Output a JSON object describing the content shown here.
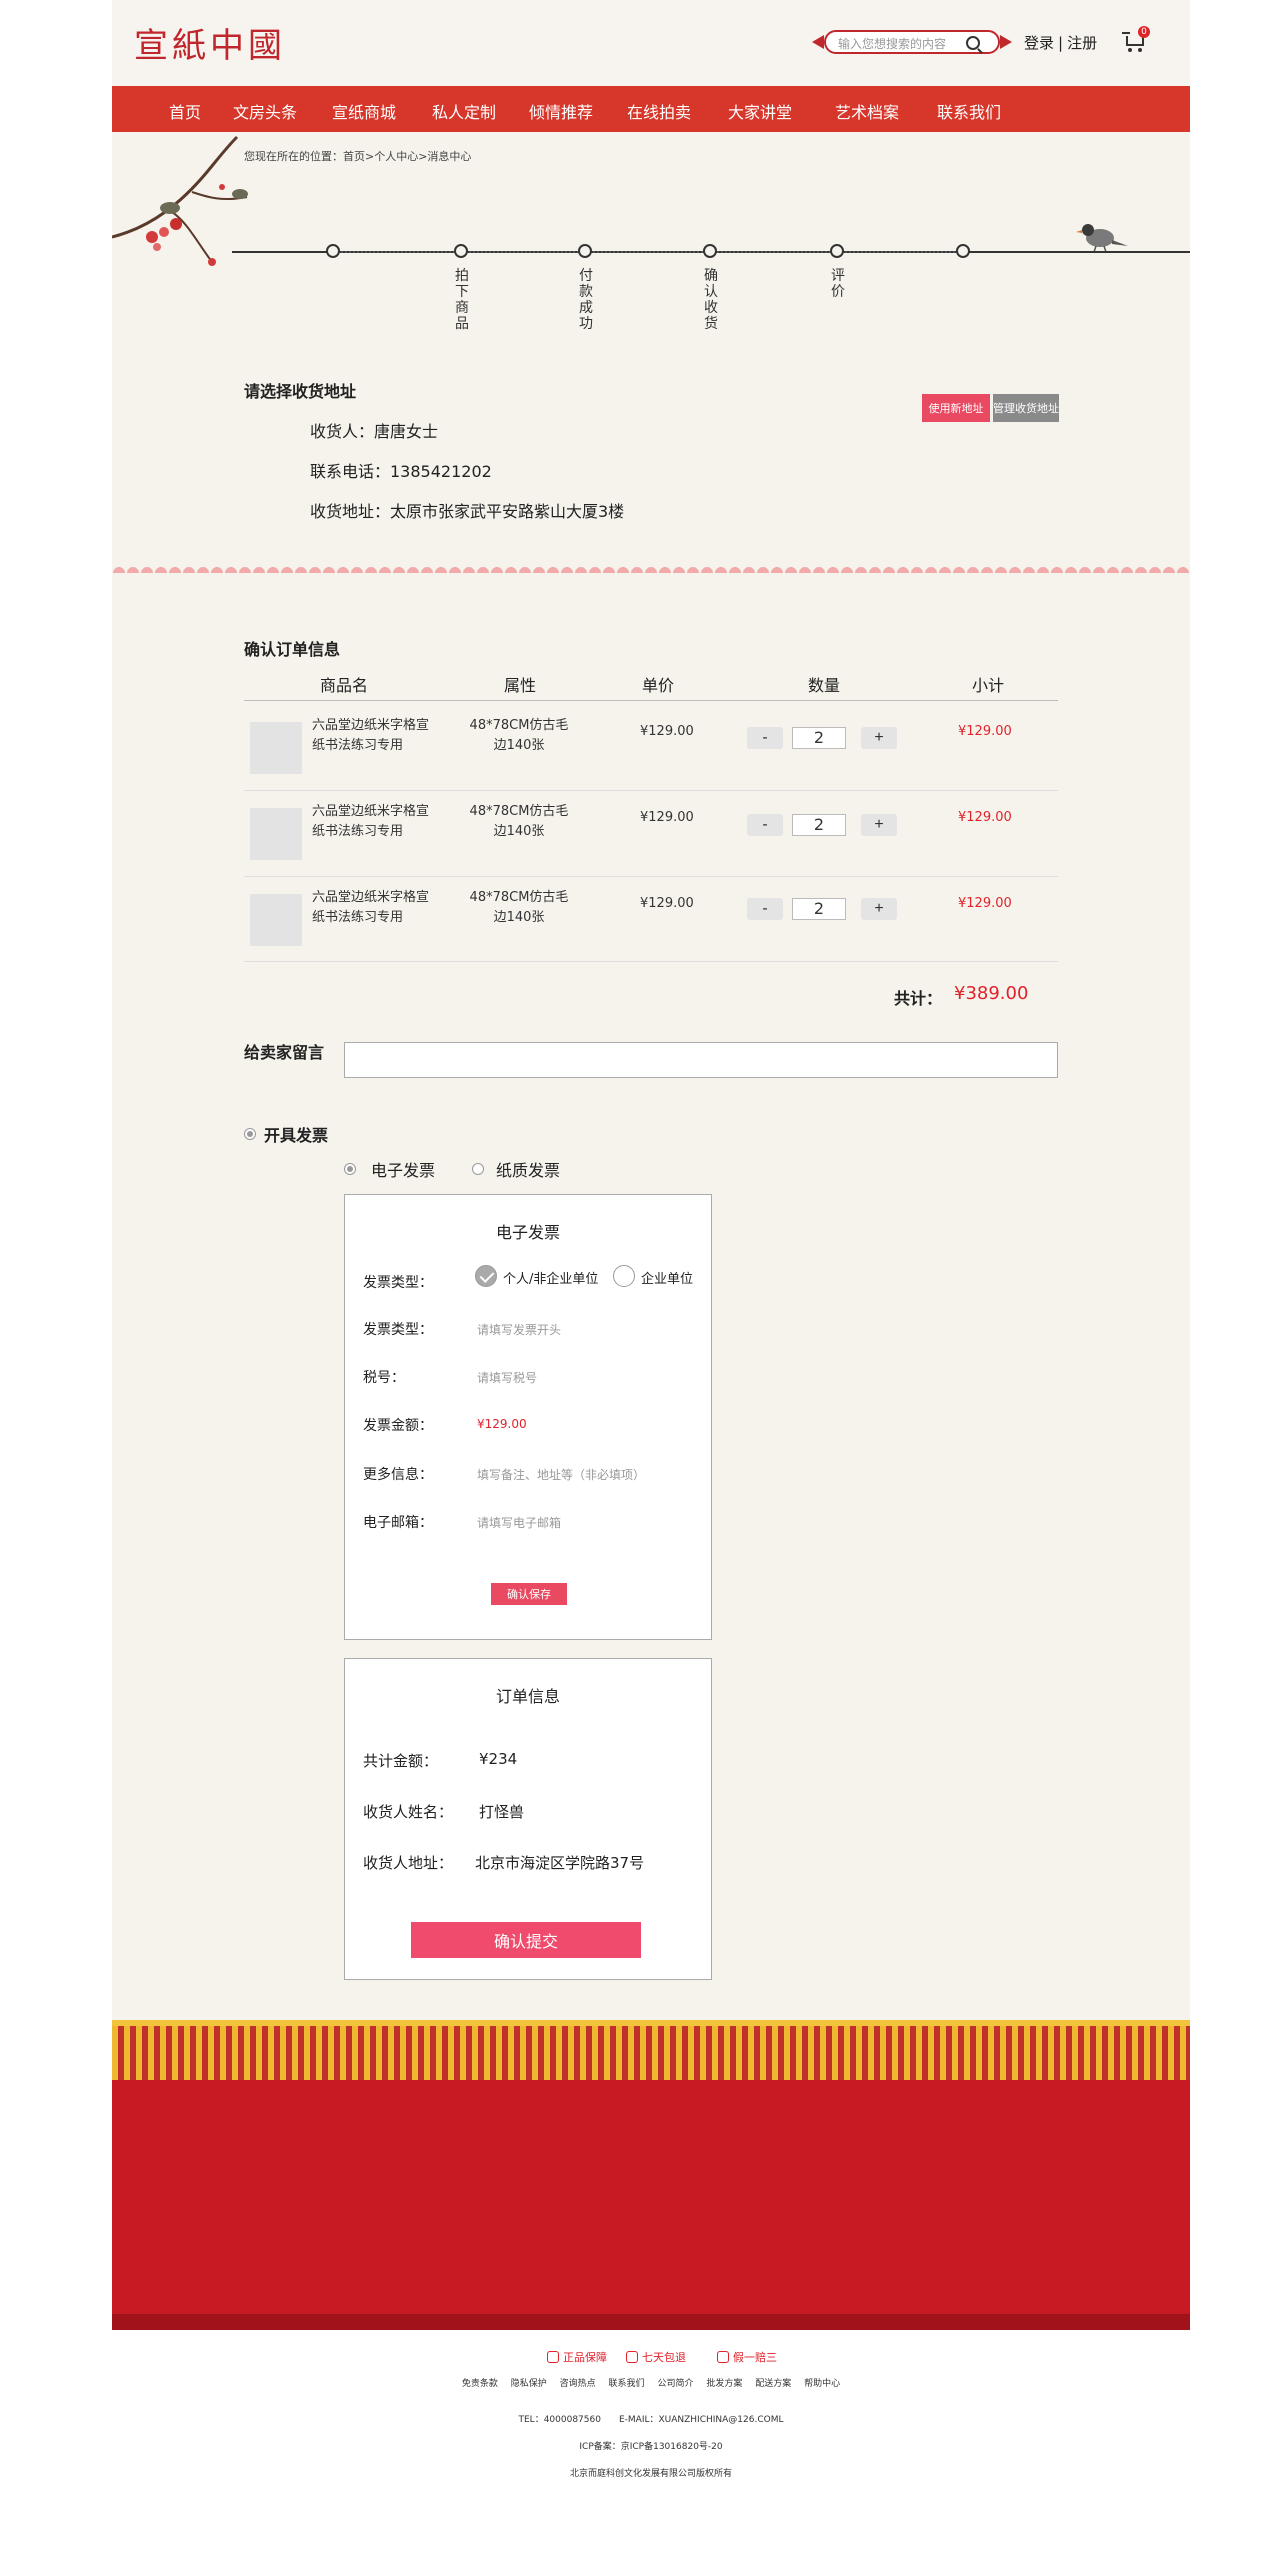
{
  "header": {
    "logo": "宣紙中國",
    "search_placeholder": "输入您想搜索的内容",
    "login": "登录",
    "separator": "|",
    "register": "注册",
    "cart_count": "0"
  },
  "nav": [
    "首页",
    "文房头条",
    "宣纸商城",
    "私人定制",
    "倾情推荐",
    "在线拍卖",
    "大家讲堂",
    "艺术档案",
    "联系我们"
  ],
  "breadcrumb": "您现在所在的位置：首页>个人中心>消息中心",
  "steps": [
    "拍下商品",
    "付款成功",
    "确认收货",
    "评价"
  ],
  "address": {
    "title": "请选择收货地址",
    "receiver": "收货人：唐唐女士",
    "phone": "联系电话：1385421202",
    "addr": "收货地址：太原市张家武平安路紫山大厦3楼",
    "use_new": "使用新地址",
    "manage": "管理收货地址"
  },
  "order": {
    "title": "确认订单信息",
    "headers": [
      "商品名",
      "属性",
      "单价",
      "数量",
      "小计"
    ],
    "items": [
      {
        "name": "六品堂边纸米字格宣纸书法练习专用",
        "attr": "48*78CM仿古毛边140张",
        "price": "¥129.00",
        "qty": "2",
        "subtotal": "¥129.00"
      },
      {
        "name": "六品堂边纸米字格宣纸书法练习专用",
        "attr": "48*78CM仿古毛边140张",
        "price": "¥129.00",
        "qty": "2",
        "subtotal": "¥129.00"
      },
      {
        "name": "六品堂边纸米字格宣纸书法练习专用",
        "attr": "48*78CM仿古毛边140张",
        "price": "¥129.00",
        "qty": "2",
        "subtotal": "¥129.00"
      }
    ],
    "minus": "-",
    "plus": "+",
    "total_label": "共计：",
    "total_value": "¥389.00"
  },
  "message": {
    "label": "给卖家留言"
  },
  "invoice": {
    "toggle_label": "开具发票",
    "type_electronic": "电子发票",
    "type_paper": "纸质发票",
    "panel_title": "电子发票",
    "type_label": "发票类型：",
    "opt_personal": "个人/非企业单位",
    "opt_company": "企业单位",
    "header_label": "发票类型：",
    "header_ph": "请填写发票开头",
    "tax_label": "税号：",
    "tax_ph": "请填写税号",
    "amount_label": "发票金额：",
    "amount_value": "¥129.00",
    "more_label": "更多信息：",
    "more_ph": "填写备注、地址等（非必填项）",
    "email_label": "电子邮箱：",
    "email_ph": "请填写电子邮箱",
    "save": "确认保存"
  },
  "summary": {
    "title": "订单信息",
    "amount_label": "共计金额：",
    "amount_value": "¥234",
    "name_label": "收货人姓名：",
    "name_value": "打怪兽",
    "addr_label": "收货人地址：",
    "addr_value": "北京市海淀区学院路37号",
    "submit": "确认提交"
  },
  "footer": {
    "guarantees": [
      "正品保障",
      "七天包退",
      "假一赔三"
    ],
    "links": [
      "免责条款",
      "隐私保护",
      "咨询热点",
      "联系我们",
      "公司简介",
      "批发方案",
      "配送方案",
      "帮助中心"
    ],
    "contact": "TEL：4000087560　　E-MAIL：XUANZHICHINA@126.COML",
    "icp": "ICP备案：京ICP备13016820号-20",
    "copyright": "北京而庭科创文化发展有限公司版权所有"
  },
  "colors": {
    "brand_red": "#d7362a",
    "price_red": "#e0222a",
    "pink_button": "#e94a62"
  }
}
